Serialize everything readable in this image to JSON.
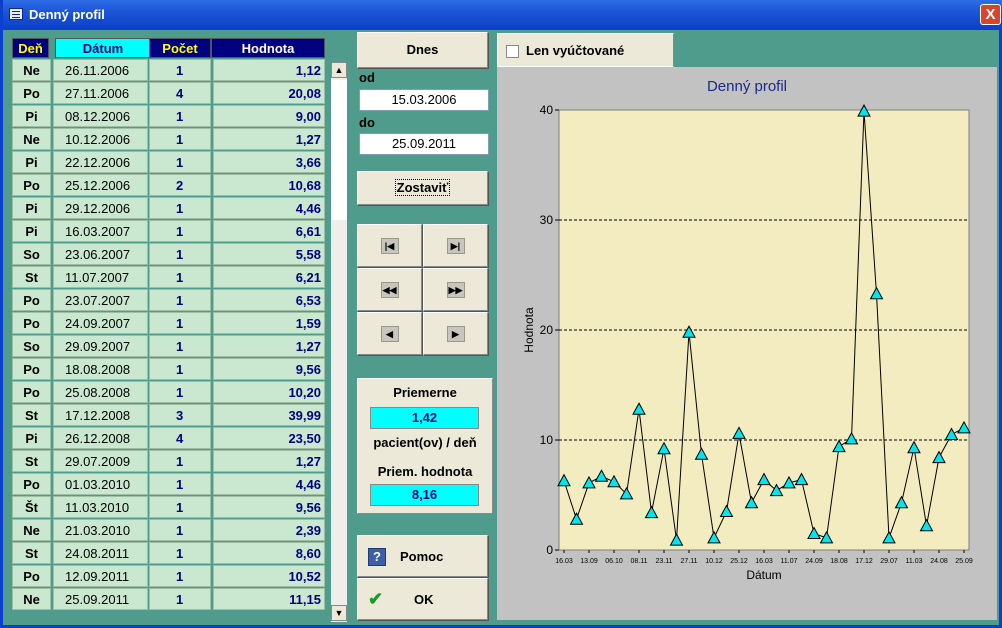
{
  "window": {
    "title": "Denný profil",
    "close_label": "X"
  },
  "table": {
    "headers": {
      "den": "Deň",
      "datum": "Dátum",
      "pocet": "Počet",
      "hodnota": "Hodnota"
    },
    "rows": [
      {
        "den": "Ne",
        "datum": "26.11.2006",
        "pocet": "1",
        "hodnota": "1,12"
      },
      {
        "den": "Po",
        "datum": "27.11.2006",
        "pocet": "4",
        "hodnota": "20,08"
      },
      {
        "den": "Pi",
        "datum": "08.12.2006",
        "pocet": "1",
        "hodnota": "9,00"
      },
      {
        "den": "Ne",
        "datum": "10.12.2006",
        "pocet": "1",
        "hodnota": "1,27"
      },
      {
        "den": "Pi",
        "datum": "22.12.2006",
        "pocet": "1",
        "hodnota": "3,66"
      },
      {
        "den": "Po",
        "datum": "25.12.2006",
        "pocet": "2",
        "hodnota": "10,68"
      },
      {
        "den": "Pi",
        "datum": "29.12.2006",
        "pocet": "1",
        "hodnota": "4,46"
      },
      {
        "den": "Pi",
        "datum": "16.03.2007",
        "pocet": "1",
        "hodnota": "6,61"
      },
      {
        "den": "So",
        "datum": "23.06.2007",
        "pocet": "1",
        "hodnota": "5,58"
      },
      {
        "den": "St",
        "datum": "11.07.2007",
        "pocet": "1",
        "hodnota": "6,21"
      },
      {
        "den": "Po",
        "datum": "23.07.2007",
        "pocet": "1",
        "hodnota": "6,53"
      },
      {
        "den": "Po",
        "datum": "24.09.2007",
        "pocet": "1",
        "hodnota": "1,59"
      },
      {
        "den": "So",
        "datum": "29.09.2007",
        "pocet": "1",
        "hodnota": "1,27"
      },
      {
        "den": "Po",
        "datum": "18.08.2008",
        "pocet": "1",
        "hodnota": "9,56"
      },
      {
        "den": "Po",
        "datum": "25.08.2008",
        "pocet": "1",
        "hodnota": "10,20"
      },
      {
        "den": "St",
        "datum": "17.12.2008",
        "pocet": "3",
        "hodnota": "39,99"
      },
      {
        "den": "Pi",
        "datum": "26.12.2008",
        "pocet": "4",
        "hodnota": "23,50"
      },
      {
        "den": "St",
        "datum": "29.07.2009",
        "pocet": "1",
        "hodnota": "1,27"
      },
      {
        "den": "Po",
        "datum": "01.03.2010",
        "pocet": "1",
        "hodnota": "4,46"
      },
      {
        "den": "Št",
        "datum": "11.03.2010",
        "pocet": "1",
        "hodnota": "9,56"
      },
      {
        "den": "Ne",
        "datum": "21.03.2010",
        "pocet": "1",
        "hodnota": "2,39"
      },
      {
        "den": "St",
        "datum": "24.08.2011",
        "pocet": "1",
        "hodnota": "8,60"
      },
      {
        "den": "Po",
        "datum": "12.09.2011",
        "pocet": "1",
        "hodnota": "10,52"
      },
      {
        "den": "Ne",
        "datum": "25.09.2011",
        "pocet": "1",
        "hodnota": "11,15"
      }
    ]
  },
  "controls": {
    "dnes_label": "Dnes",
    "od_label": "od",
    "od_value": "15.03.2006",
    "do_label": "do",
    "do_value": "25.09.2011",
    "zostavit_label": "Zostaviť",
    "nav": {
      "first_icon": "skip-to-first-icon",
      "last_icon": "skip-to-last-icon",
      "rewind_icon": "rewind-icon",
      "forward_icon": "fast-forward-icon",
      "prev_icon": "previous-icon",
      "next_icon": "next-icon"
    },
    "avg_title": "Priemerne",
    "avg_patients": "1,42",
    "avg_patients_label": "pacient(ov) / deň",
    "avg_value_label": "Priem. hodnota",
    "avg_value": "8,16",
    "help_label": "Pomoc",
    "ok_label": "OK"
  },
  "filter": {
    "checkbox_label": "Len vyúčtované",
    "checked": false
  },
  "chart_data": {
    "type": "line",
    "title": "Denný profil",
    "xlabel": "Dátum",
    "ylabel": "Hodnota",
    "ylim": [
      0,
      40
    ],
    "yticks": [
      0,
      10,
      20,
      30,
      40
    ],
    "grid": "horizontal-dashed",
    "marker": "triangle",
    "line_color": "#000000",
    "marker_color": "#00e5f0",
    "plot_bg": "#f2ecc0",
    "xtick_labels": [
      "16.03",
      "13.09",
      "06.10",
      "08.11",
      "23.11",
      "27.11",
      "10.12",
      "25.12",
      "16.03",
      "11.07",
      "24.09",
      "18.08",
      "17.12",
      "29.07",
      "11.03",
      "24.08",
      "25.09"
    ],
    "values": [
      6.3,
      2.8,
      6.1,
      6.7,
      6.2,
      5.1,
      12.8,
      3.4,
      9.2,
      0.9,
      19.8,
      8.7,
      1.1,
      3.5,
      10.6,
      4.3,
      6.4,
      5.4,
      6.1,
      6.4,
      1.5,
      1.1,
      9.4,
      10.1,
      39.9,
      23.3,
      1.1,
      4.3,
      9.3,
      2.2,
      8.4,
      10.5,
      11.1
    ]
  }
}
